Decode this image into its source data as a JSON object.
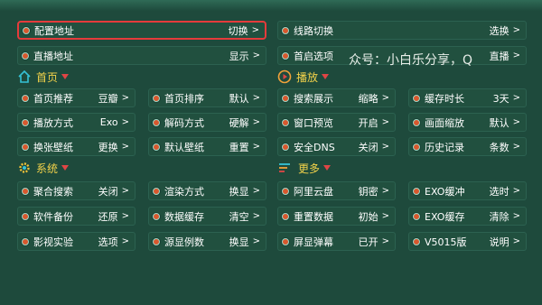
{
  "top": {
    "config_address": {
      "label": "配置地址",
      "value": "切换"
    },
    "route_switch": {
      "label": "线路切换",
      "value": "选换"
    },
    "live_address": {
      "label": "直播地址",
      "value": "显示"
    },
    "startup_option": {
      "label": "首启选项",
      "value": "直播"
    }
  },
  "overlay_text": "众号：小白乐分享，Q",
  "sections": {
    "home": "首页",
    "playback": "播放",
    "system": "系统",
    "more": "更多"
  },
  "home": [
    {
      "label": "首页推荐",
      "value": "豆瓣"
    },
    {
      "label": "首页排序",
      "value": "默认"
    },
    {
      "label": "播放方式",
      "value": "Exo"
    },
    {
      "label": "解码方式",
      "value": "硬解"
    },
    {
      "label": "换张壁纸",
      "value": "更换"
    },
    {
      "label": "默认壁纸",
      "value": "重置"
    }
  ],
  "playback": [
    {
      "label": "搜索展示",
      "value": "缩略"
    },
    {
      "label": "缓存时长",
      "value": "3天"
    },
    {
      "label": "窗口预览",
      "value": "开启"
    },
    {
      "label": "画面缩放",
      "value": "默认"
    },
    {
      "label": "安全DNS",
      "value": "关闭"
    },
    {
      "label": "历史记录",
      "value": "条数"
    }
  ],
  "system": [
    {
      "label": "聚合搜索",
      "value": "关闭"
    },
    {
      "label": "渲染方式",
      "value": "换显"
    },
    {
      "label": "软件备份",
      "value": "还原"
    },
    {
      "label": "数据缓存",
      "value": "清空"
    },
    {
      "label": "影视实验",
      "value": "选项"
    },
    {
      "label": "源显例数",
      "value": "换显"
    }
  ],
  "more": [
    {
      "label": "阿里云盘",
      "value": "钥密"
    },
    {
      "label": "EXO缓冲",
      "value": "选时"
    },
    {
      "label": "重置数据",
      "value": "初始"
    },
    {
      "label": "EXO缓存",
      "value": "清除"
    },
    {
      "label": "屏显弹幕",
      "value": "已开"
    },
    {
      "label": "V5015版",
      "value": "说明"
    }
  ],
  "arrow": ">",
  "colors": {
    "background": "#1e4a3c",
    "button": "#21503f",
    "section_title": "#f3d24a",
    "selected_border": "#e53b3b",
    "dot": "#d8582e"
  },
  "icons": {
    "home": "home-icon",
    "playback": "play-circle-icon",
    "system": "gear-icon",
    "more": "menu-lines-icon"
  }
}
